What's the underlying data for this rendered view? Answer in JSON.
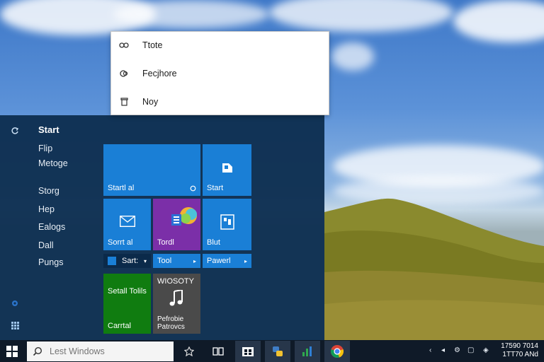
{
  "context_menu": {
    "items": [
      {
        "icon": "link-icon",
        "label": "Ttote"
      },
      {
        "icon": "share-icon",
        "label": "Fecjhore"
      },
      {
        "icon": "trash-icon",
        "label": "Noy"
      }
    ]
  },
  "start_menu": {
    "title": "Start",
    "links": [
      "Flip",
      "Metoge",
      "Storg",
      "Hep",
      "Ealogs",
      "Dall",
      "Pungs"
    ],
    "tiles": {
      "t1": "Startl al",
      "t2": "Start",
      "t3": "Sorrt al",
      "t4": "Tordl",
      "t5": "Blut",
      "bar1": "Sart:",
      "bar2": "Tool",
      "bar3": "Pawerl",
      "green_top": "Setall Tolils",
      "green_bottom": "Carrtal",
      "music_top": "WIOSOTY",
      "music_bottom": "Pefrobie Patrovcs"
    }
  },
  "taskbar": {
    "search_placeholder": "Lest Windows",
    "clock_time": "17590 7014",
    "clock_date": "1TT70 ANd"
  },
  "colors": {
    "tile_blue": "#1a7fd6",
    "tile_green": "#107c10",
    "tile_purple": "#7b2fa8",
    "tile_gray": "#4a4a4a",
    "start_bg": "#0e3052",
    "taskbar_bg": "#0f1a28"
  }
}
